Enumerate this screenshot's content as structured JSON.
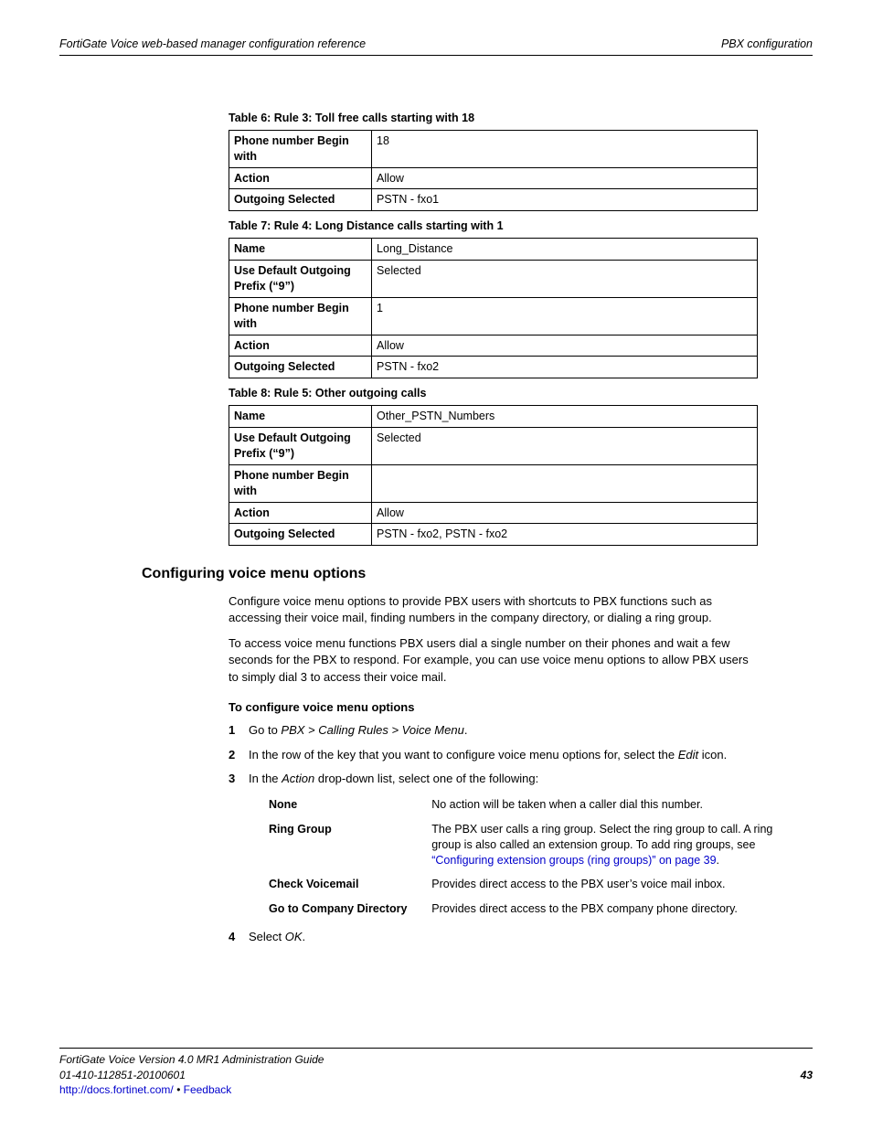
{
  "header": {
    "left": "FortiGate Voice web-based manager configuration reference",
    "right": "PBX configuration"
  },
  "t6": {
    "cap": "Table 6: Rule 3: Toll free calls starting with 18",
    "r1l": "Phone number Begin with",
    "r1v": "18",
    "r2l": "Action",
    "r2v": "Allow",
    "r3l": "Outgoing Selected",
    "r3v": "PSTN - fxo1"
  },
  "t7": {
    "cap": "Table 7: Rule 4: Long Distance calls starting with 1",
    "r1l": "Name",
    "r1v": "Long_Distance",
    "r2l": "Use Default Outgoing Prefix (“9”)",
    "r2v": "Selected",
    "r3l": "Phone number Begin with",
    "r3v": "1",
    "r4l": "Action",
    "r4v": "Allow",
    "r5l": "Outgoing Selected",
    "r5v": "PSTN - fxo2"
  },
  "t8": {
    "cap": "Table 8: Rule 5: Other outgoing calls",
    "r1l": "Name",
    "r1v": "Other_PSTN_Numbers",
    "r2l": "Use Default Outgoing Prefix (“9”)",
    "r2v": "Selected",
    "r3l": "Phone number Begin with",
    "r3v": "",
    "r4l": "Action",
    "r4v": "Allow",
    "r5l": "Outgoing Selected",
    "r5v": "PSTN - fxo2, PSTN - fxo2"
  },
  "sect": "Configuring voice menu options",
  "p1": "Configure voice menu options to provide PBX users with shortcuts to PBX functions such as accessing their voice mail, finding numbers in the company directory, or dialing a ring group.",
  "p2": "To access voice menu functions PBX users dial a single number on their phones and wait a few seconds for the PBX to respond. For example, you can use voice menu options to allow PBX users to simply dial 3 to access their voice mail.",
  "sub": "To configure voice menu options",
  "s1a": "Go to ",
  "s1b": "PBX > Calling Rules > Voice Menu",
  "s1c": ".",
  "s2a": "In the row of the key that you want to configure voice menu options for, select the ",
  "s2b": "Edit",
  "s2c": " icon.",
  "s3a": "In the ",
  "s3b": "Action",
  "s3c": " drop-down list, select one of the following:",
  "d": {
    "r1l": "None",
    "r1v": "No action will be taken when a caller dial this number.",
    "r2l": "Ring Group",
    "r2v1": "The PBX user calls a ring group. Select the ring group to call. A ring group is also called an extension group. To add ring groups, see ",
    "r2link": "“Configuring extension groups (ring groups)” on page 39",
    "r2v2": ".",
    "r3l": "Check Voicemail",
    "r3v": "Provides direct access to the PBX user’s voice mail inbox.",
    "r4l": "Go to Company Directory",
    "r4v": "Provides direct access to the PBX company phone directory."
  },
  "s4a": "Select ",
  "s4b": "OK",
  "s4c": ".",
  "footer": {
    "l1": "FortiGate Voice Version 4.0 MR1 Administration Guide",
    "l2": "01-410-112851-20100601",
    "pg": "43",
    "url": "http://docs.fortinet.com/",
    "sep": " • ",
    "fb": "Feedback"
  }
}
